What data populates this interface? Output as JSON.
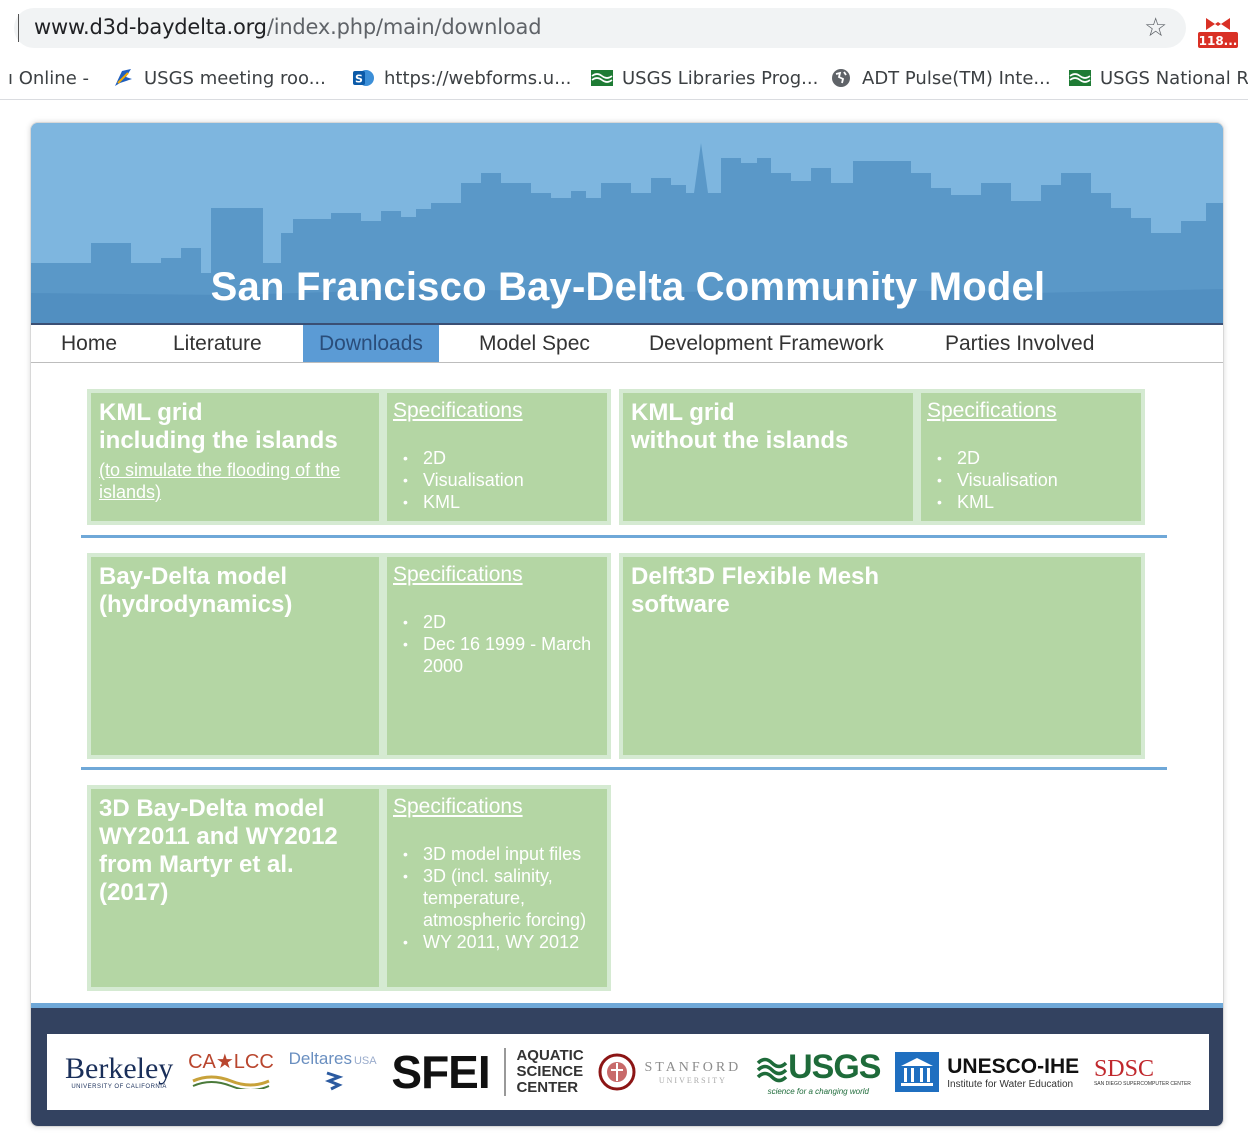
{
  "browser": {
    "url_domain": "www.d3d-baydelta.org",
    "url_path": "/index.php/main/download",
    "bookmarks": [
      {
        "label": "ı Online -"
      },
      {
        "label": "USGS meeting roo..."
      },
      {
        "label": "https://webforms.u..."
      },
      {
        "label": "USGS Libraries Prog..."
      },
      {
        "label": "ADT Pulse(TM) Inte..."
      },
      {
        "label": "USGS National R"
      }
    ],
    "gmail_badge": "118..."
  },
  "site": {
    "title": "San Francisco Bay-Delta Community Model",
    "nav": [
      {
        "label": "Home"
      },
      {
        "label": "Literature"
      },
      {
        "label": "Downloads"
      },
      {
        "label": "Model Spec"
      },
      {
        "label": "Development Framework"
      },
      {
        "label": "Parties Involved"
      }
    ]
  },
  "downloads": {
    "kml_islands": {
      "title_line1": "KML grid",
      "title_line2": "including the islands",
      "note": "(to simulate the flooding of the islands)",
      "spec_heading": "Specifications",
      "specs": [
        "2D",
        "Visualisation",
        "KML"
      ]
    },
    "kml_no_islands": {
      "title_line1": "KML grid",
      "title_line2": "without the islands",
      "spec_heading": "Specifications",
      "specs": [
        "2D",
        "Visualisation",
        "KML"
      ]
    },
    "baydelta_hydro": {
      "title_line1": "Bay-Delta model",
      "title_line2": "(hydrodynamics)",
      "spec_heading": "Specifications",
      "specs": [
        "2D",
        "Dec 16 1999 - March 2000"
      ]
    },
    "delft3d": {
      "title_line1": "Delft3D Flexible Mesh",
      "title_line2": "software"
    },
    "baydelta_3d": {
      "title_line1": "3D Bay-Delta model",
      "title_line2": "WY2011 and WY2012",
      "title_line3": "from Martyr et al.",
      "title_line4": "(2017)",
      "spec_heading": "Specifications",
      "specs": [
        "3D model input files",
        "3D (incl. salinity, temperature, atmospheric forcing)",
        "WY 2011, WY 2012"
      ]
    }
  },
  "footer_logos": {
    "berkeley": "Berkeley",
    "berkeley_sub": "UNIVERSITY OF CALIFORNIA",
    "calcc": "CA★LCC",
    "deltares": "Deltares",
    "deltares_usa": "USA",
    "sfei": "SFEI",
    "asc_1": "AQUATIC",
    "asc_2": "SCIENCE",
    "asc_3": "CENTER",
    "stanford": "STANFORD",
    "stanford_sub": "UNIVERSITY",
    "usgs": "USGS",
    "usgs_sub": "science for a changing world",
    "unesco": "UNESCO-IHE",
    "unesco_sub": "Institute for Water Education",
    "sdsc": "SDSC",
    "sdsc_sub": "SAN DIEGO SUPERCOMPUTER CENTER"
  }
}
